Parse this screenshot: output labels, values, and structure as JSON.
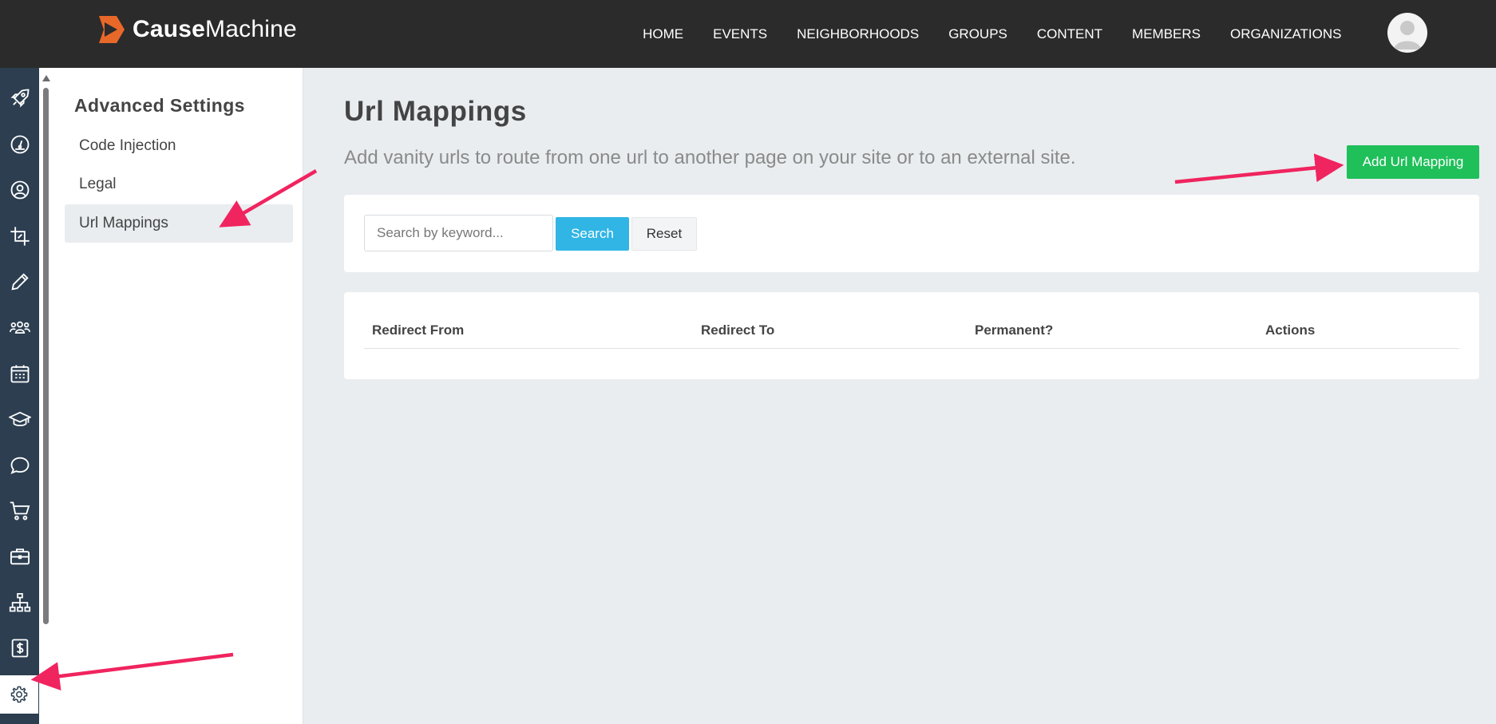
{
  "app": {
    "logo_bold": "Cause",
    "logo_light": "Machine"
  },
  "nav": {
    "items": [
      {
        "label": "HOME"
      },
      {
        "label": "EVENTS"
      },
      {
        "label": "NEIGHBORHOODS"
      },
      {
        "label": "GROUPS"
      },
      {
        "label": "CONTENT"
      },
      {
        "label": "MEMBERS"
      },
      {
        "label": "ORGANIZATIONS"
      }
    ]
  },
  "rail": {
    "icons": [
      "rocket-icon",
      "dashboard-icon",
      "user-circle-icon",
      "crop-icon",
      "pencil-icon",
      "users-icon",
      "calendar-icon",
      "graduation-cap-icon",
      "chat-icon",
      "cart-icon",
      "briefcase-icon",
      "sitemap-icon",
      "dollar-icon",
      "gear-icon"
    ],
    "active": "gear-icon"
  },
  "sidebar": {
    "title": "Advanced Settings",
    "items": [
      {
        "label": "Code Injection"
      },
      {
        "label": "Legal"
      },
      {
        "label": "Url Mappings",
        "active": true
      }
    ]
  },
  "main": {
    "title": "Url Mappings",
    "description": "Add vanity urls to route from one url to another page on your site or to an external site.",
    "add_button": "Add Url Mapping",
    "search": {
      "placeholder": "Search by keyword...",
      "value": "",
      "search_label": "Search",
      "reset_label": "Reset"
    },
    "table": {
      "columns": [
        "Redirect From",
        "Redirect To",
        "Permanent?",
        "Actions"
      ],
      "rows": []
    }
  },
  "colors": {
    "topbar": "#2b2b2b",
    "rail": "#2c3e50",
    "add_button": "#1fbf5a",
    "search_button": "#30b5e4",
    "annotation_arrow": "#f0245f",
    "logo_orange": "#e8682a"
  }
}
